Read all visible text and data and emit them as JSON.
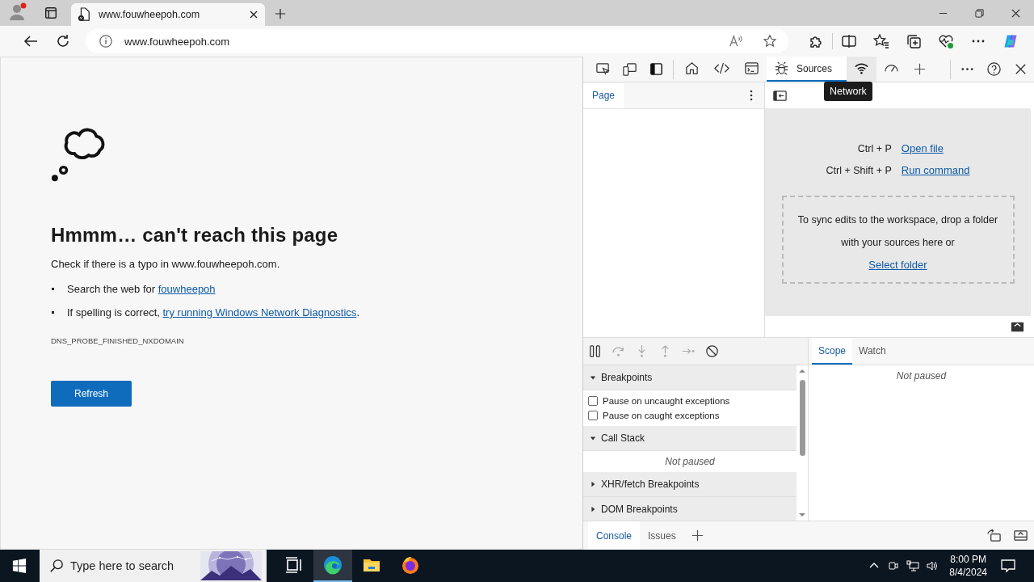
{
  "browser_tabs": [
    {
      "title": "www.fouwheepoh.com",
      "selected": true
    }
  ],
  "address_bar": {
    "url": "www.fouwheepoh.com"
  },
  "page": {
    "heading": "Hmmm… can't reach this page",
    "intro": "Check if there is a typo in www.fouwheepoh.com.",
    "suggestions": [
      {
        "text": "Search the web for",
        "link": "fouwheepoh"
      },
      {
        "text": "If spelling is correct,",
        "link": "try running Windows Network Diagnostics",
        "after": "."
      }
    ],
    "error_code": "DNS_PROBE_FINISHED_NXDOMAIN",
    "button": "Refresh"
  },
  "devtools": {
    "tabs": [
      {
        "kind": "home",
        "selected": false,
        "hovered": false
      },
      {
        "kind": "elements",
        "selected": false,
        "hovered": false
      },
      {
        "kind": "console",
        "selected": false,
        "hovered": false
      },
      {
        "kind": "sources",
        "label": "Sources",
        "selected": true,
        "hovered": false
      },
      {
        "kind": "network",
        "selected": false,
        "hovered": true
      },
      {
        "kind": "performance",
        "selected": false,
        "hovered": false
      }
    ],
    "tooltip": "Network",
    "navigator_tabs": [
      {
        "label": "Page",
        "selected": true
      }
    ],
    "shortcuts": [
      {
        "keys": "Ctrl + P",
        "action": "Open file"
      },
      {
        "keys": "Ctrl + Shift + P",
        "action": "Run command"
      }
    ],
    "drop_hint": "To sync edits to the workspace, drop a folder with your sources here or",
    "drop_link": "Select folder",
    "sections": [
      {
        "title": "Breakpoints",
        "expanded": true,
        "kind": "checkboxes",
        "items": [
          {
            "label": "Pause on uncaught exceptions",
            "checked": false
          },
          {
            "label": "Pause on caught exceptions",
            "checked": false
          }
        ]
      },
      {
        "title": "Call Stack",
        "expanded": true,
        "kind": "message",
        "message": "Not paused"
      },
      {
        "title": "XHR/fetch Breakpoints",
        "expanded": false
      },
      {
        "title": "DOM Breakpoints",
        "expanded": false
      }
    ],
    "side_tabs": [
      {
        "label": "Scope",
        "selected": true
      },
      {
        "label": "Watch",
        "selected": false
      }
    ],
    "side_message": "Not paused",
    "drawer_tabs": [
      {
        "label": "Console",
        "selected": true
      },
      {
        "label": "Issues",
        "selected": false
      }
    ]
  },
  "taskbar": {
    "search_placeholder": "Type here to search",
    "apps": [
      {
        "kind": "taskview",
        "active": false
      },
      {
        "kind": "edge",
        "active": true
      },
      {
        "kind": "files",
        "active": false
      },
      {
        "kind": "firefox",
        "active": false
      }
    ],
    "time": "8:00 PM",
    "date": "8/4/2024"
  }
}
